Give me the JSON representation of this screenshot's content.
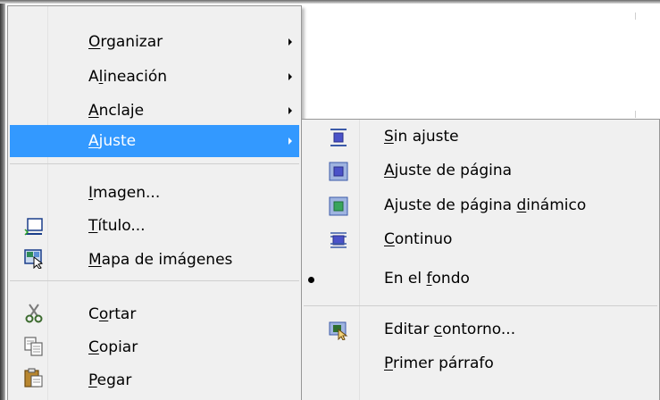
{
  "main_menu": {
    "items": [
      {
        "pre": "",
        "key": "O",
        "post": "rganizar",
        "submenu": true,
        "icon": null
      },
      {
        "pre": "A",
        "key": "l",
        "post": "ineación",
        "submenu": true,
        "icon": null
      },
      {
        "pre": "",
        "key": "A",
        "post": "nclaje",
        "submenu": true,
        "icon": null
      },
      {
        "pre": "",
        "key": "A",
        "post": "juste",
        "submenu": true,
        "icon": null,
        "highlighted": true
      },
      {
        "pre": "",
        "key": "I",
        "post": "magen...",
        "submenu": false,
        "icon": null
      },
      {
        "pre": "",
        "key": "T",
        "post": "ítulo...",
        "submenu": false,
        "icon": "caption-icon"
      },
      {
        "pre": "",
        "key": "M",
        "post": "apa de imágenes",
        "submenu": false,
        "icon": "image-map-icon"
      },
      {
        "pre": "C",
        "key": "o",
        "post": "rtar",
        "submenu": false,
        "icon": "scissors-icon"
      },
      {
        "pre": "",
        "key": "C",
        "post": "opiar",
        "submenu": false,
        "icon": "copy-icon"
      },
      {
        "pre": "",
        "key": "P",
        "post": "egar",
        "submenu": false,
        "icon": "paste-icon"
      }
    ]
  },
  "sub_menu": {
    "items": [
      {
        "pre": "",
        "key": "S",
        "post": "in ajuste",
        "icon": "wrap-none-icon"
      },
      {
        "pre": "",
        "key": "A",
        "post": "juste de página",
        "icon": "wrap-page-icon"
      },
      {
        "pre": "Ajuste de página ",
        "key": "d",
        "post": "inámico",
        "icon": "wrap-dynamic-icon"
      },
      {
        "pre": "",
        "key": "C",
        "post": "ontinuo",
        "icon": "wrap-through-icon"
      },
      {
        "pre": "En el ",
        "key": "f",
        "post": "ondo",
        "icon": "bullet",
        "checked": true
      },
      {
        "pre": "Editar ",
        "key": "c",
        "post": "ontorno...",
        "icon": "edit-contour-icon"
      },
      {
        "pre": "",
        "key": "P",
        "post": "rimer párrafo",
        "icon": null
      }
    ]
  },
  "colors": {
    "highlight": "#3399ff",
    "menu_bg": "#f0f0f0",
    "border": "#979797"
  }
}
